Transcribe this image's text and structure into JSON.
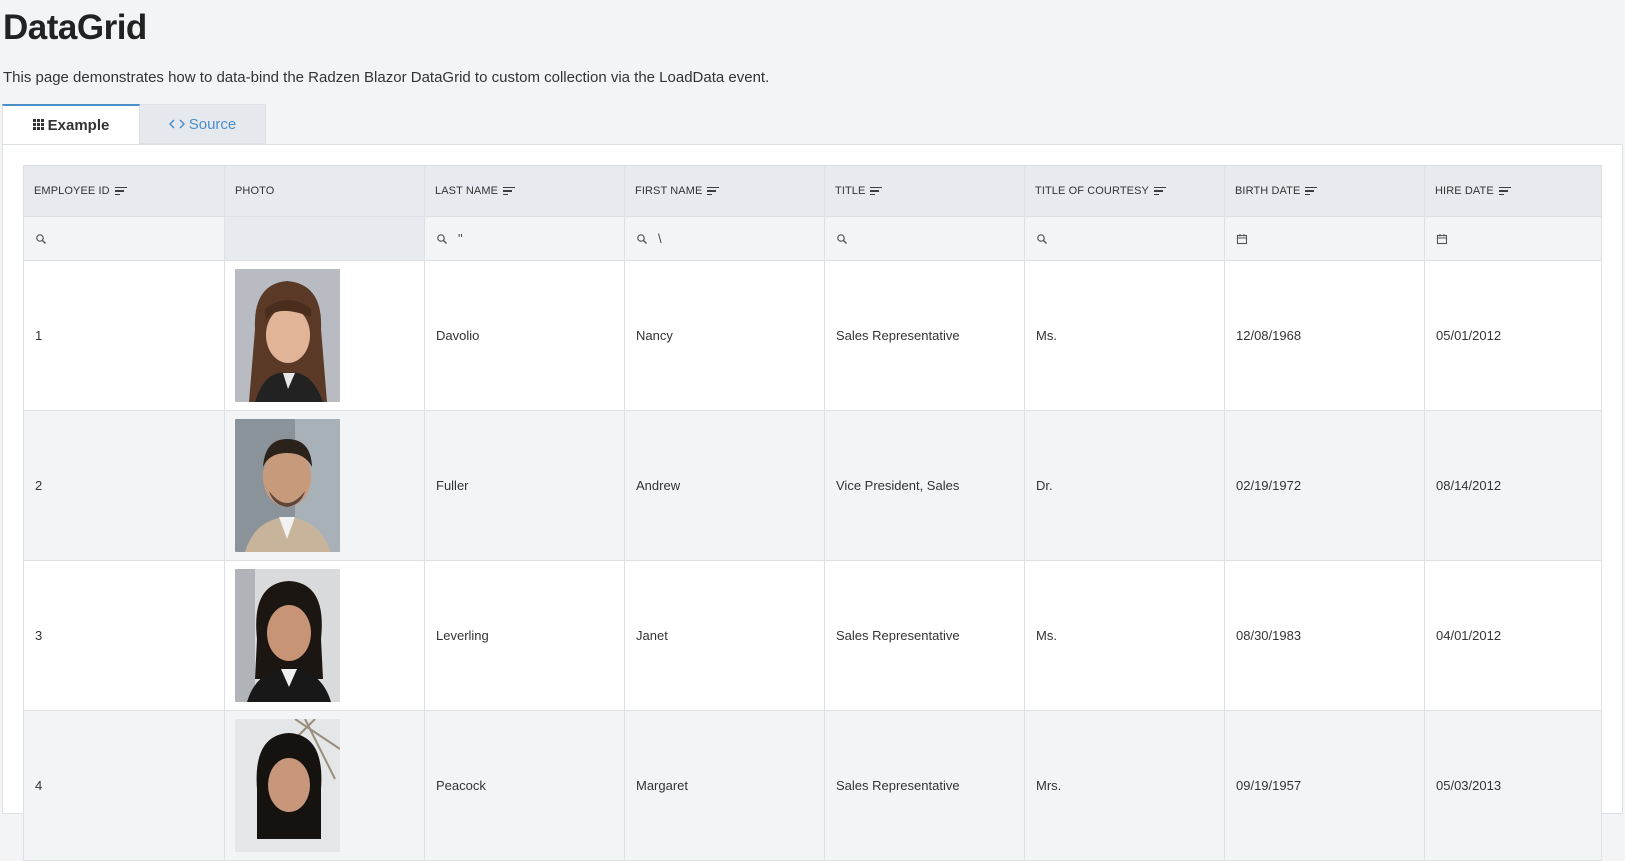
{
  "page": {
    "title": "DataGrid",
    "description": "This page demonstrates how to data-bind the Radzen Blazor DataGrid to custom collection via the LoadData event."
  },
  "tabs": [
    {
      "label": "Example",
      "icon": "grid-icon",
      "active": true
    },
    {
      "label": "Source",
      "icon": "code-icon",
      "active": false
    }
  ],
  "grid": {
    "columns": [
      {
        "label": "Employee ID",
        "sortable": true,
        "filter": "search"
      },
      {
        "label": "Photo",
        "sortable": false,
        "filter": "none"
      },
      {
        "label": "Last Name",
        "sortable": true,
        "filter": "search",
        "filter_value": "\""
      },
      {
        "label": "First Name",
        "sortable": true,
        "filter": "search",
        "filter_value": "\\"
      },
      {
        "label": "Title",
        "sortable": true,
        "filter": "search"
      },
      {
        "label": "Title of Courtesy",
        "sortable": true,
        "filter": "search"
      },
      {
        "label": "Birth Date",
        "sortable": true,
        "filter": "calendar"
      },
      {
        "label": "Hire Date",
        "sortable": true,
        "filter": "calendar"
      }
    ],
    "rows": [
      {
        "id": "1",
        "photo": "employee-photo",
        "last_name": "Davolio",
        "first_name": "Nancy",
        "title": "Sales Representative",
        "courtesy": "Ms.",
        "birth_date": "12/08/1968",
        "hire_date": "05/01/2012"
      },
      {
        "id": "2",
        "photo": "employee-photo",
        "last_name": "Fuller",
        "first_name": "Andrew",
        "title": "Vice President, Sales",
        "courtesy": "Dr.",
        "birth_date": "02/19/1972",
        "hire_date": "08/14/2012"
      },
      {
        "id": "3",
        "photo": "employee-photo",
        "last_name": "Leverling",
        "first_name": "Janet",
        "title": "Sales Representative",
        "courtesy": "Ms.",
        "birth_date": "08/30/1983",
        "hire_date": "04/01/2012"
      },
      {
        "id": "4",
        "photo": "employee-photo",
        "last_name": "Peacock",
        "first_name": "Margaret",
        "title": "Sales Representative",
        "courtesy": "Mrs.",
        "birth_date": "09/19/1957",
        "hire_date": "05/03/2013"
      }
    ]
  },
  "colors": {
    "accent": "#4a8fc9",
    "header_bg": "#e7ebef",
    "page_bg": "#f3f4f6"
  }
}
